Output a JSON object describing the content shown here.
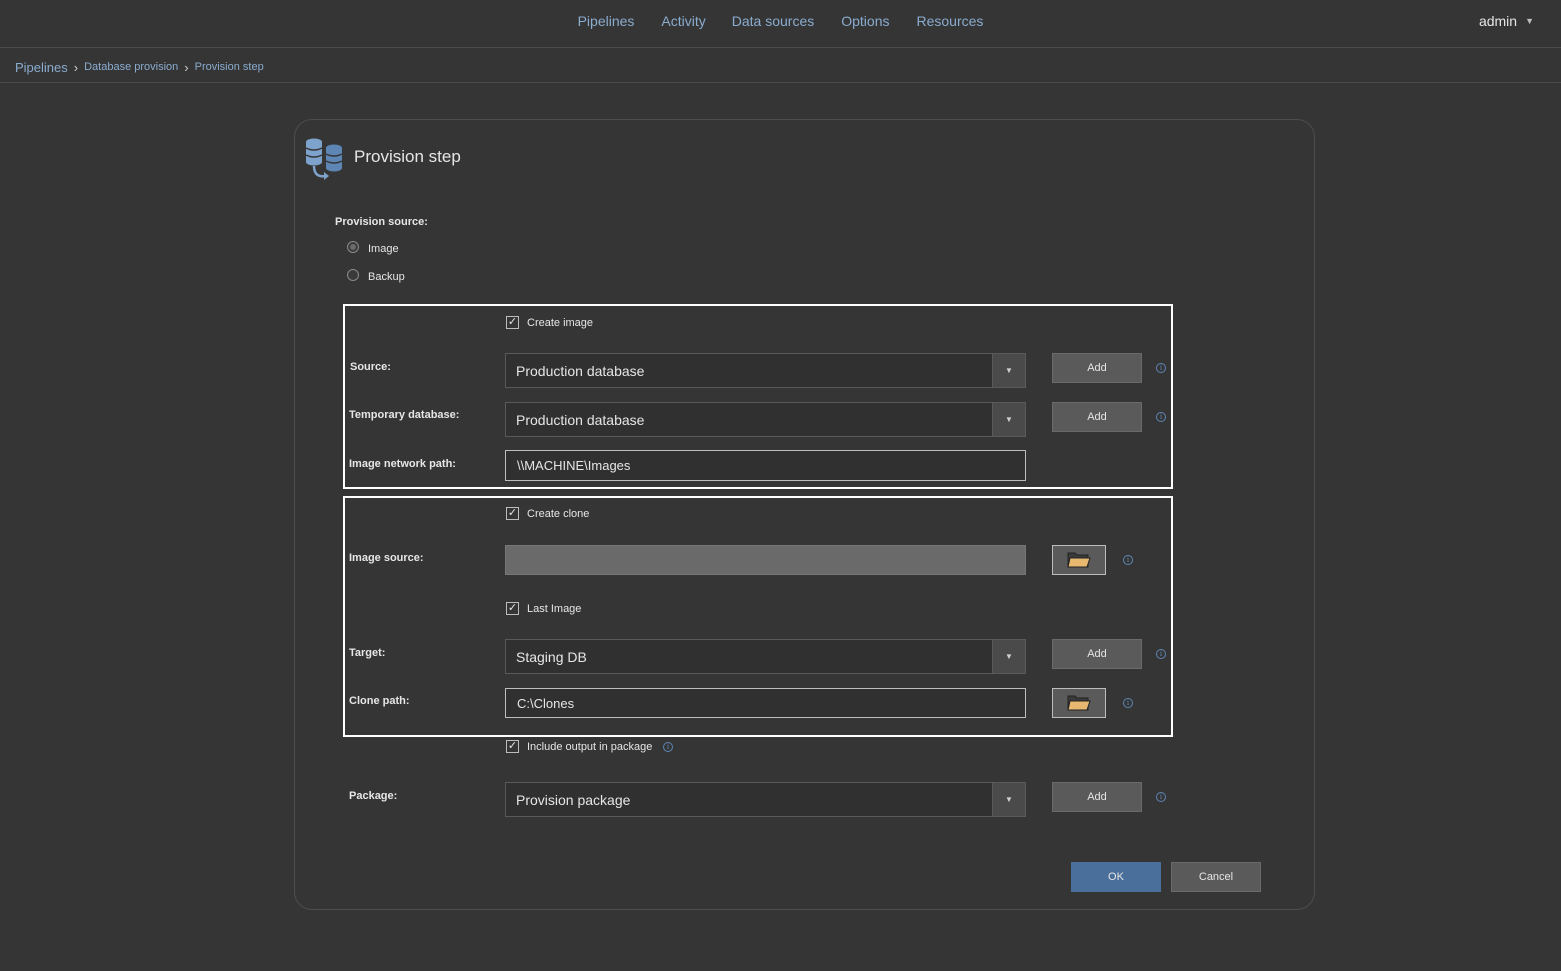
{
  "nav": {
    "links": [
      "Pipelines",
      "Activity",
      "Data sources",
      "Options",
      "Resources"
    ],
    "user": "admin"
  },
  "breadcrumb": {
    "root": "Pipelines",
    "level1": "Database provision",
    "level2": "Provision step"
  },
  "dialog": {
    "title": "Provision step",
    "provision_source_label": "Provision source:",
    "radio_image": "Image",
    "radio_backup": "Backup",
    "selected_source": "Image",
    "create_image": {
      "checkbox_label": "Create image",
      "checked": true,
      "source_label": "Source:",
      "source_value": "Production database",
      "temp_db_label": "Temporary database:",
      "temp_db_value": "Production database",
      "network_path_label": "Image network path:",
      "network_path_value": "\\\\MACHINE\\Images"
    },
    "create_clone": {
      "checkbox_label": "Create clone",
      "checked": true,
      "image_source_label": "Image source:",
      "image_source_value": "",
      "last_image_label": "Last Image",
      "last_image_checked": true,
      "target_label": "Target:",
      "target_value": "Staging DB",
      "clone_path_label": "Clone path:",
      "clone_path_value": "C:\\Clones"
    },
    "include_output_label": "Include output in package",
    "include_output_checked": true,
    "package_label": "Package:",
    "package_value": "Provision package",
    "add_label": "Add",
    "ok_label": "OK",
    "cancel_label": "Cancel"
  },
  "colors": {
    "background": "#353535",
    "link": "#8aaccf",
    "primary_button": "#4a6f9a",
    "folder_icon": "#e8b870"
  }
}
